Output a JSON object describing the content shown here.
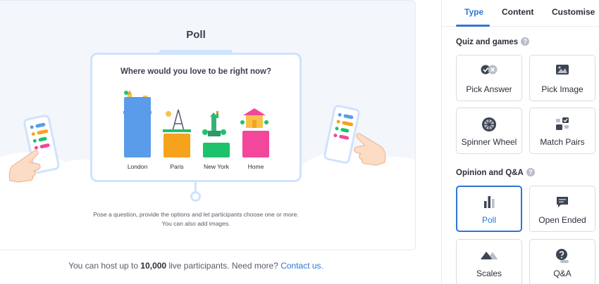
{
  "preview": {
    "title": "Poll",
    "question": "Where would you love to be right now?",
    "bars": [
      {
        "label": "London",
        "value": 5,
        "color": "#5a9ce9"
      },
      {
        "label": "Paris",
        "value": 2,
        "color": "#f6a21d"
      },
      {
        "label": "New York",
        "value": 1.2,
        "color": "#1ec26a"
      },
      {
        "label": "Home",
        "value": 2.2,
        "color": "#f2479a"
      }
    ],
    "description_line1": "Pose a question, provide the options and let participants choose one or more.",
    "description_line2": "You can also add images."
  },
  "footer": {
    "text_before": "You can host up to ",
    "count": "10,000",
    "text_after": " live participants. Need more? ",
    "link": "Contact us."
  },
  "sidebar": {
    "tabs": [
      {
        "label": "Type",
        "active": true
      },
      {
        "label": "Content",
        "active": false
      },
      {
        "label": "Customise",
        "active": false
      }
    ],
    "sections": [
      {
        "title": "Quiz and games",
        "help": "?",
        "cards": [
          {
            "label": "Pick Answer",
            "icon": "check-x-icon",
            "selected": false
          },
          {
            "label": "Pick Image",
            "icon": "image-icon",
            "selected": false
          },
          {
            "label": "Spinner Wheel",
            "icon": "wheel-icon",
            "selected": false
          },
          {
            "label": "Match Pairs",
            "icon": "match-pairs-icon",
            "selected": false
          }
        ]
      },
      {
        "title": "Opinion and Q&A",
        "help": "?",
        "cards": [
          {
            "label": "Poll",
            "icon": "bar-chart-icon",
            "selected": true
          },
          {
            "label": "Open Ended",
            "icon": "chat-icon",
            "selected": false
          },
          {
            "label": "Scales",
            "icon": "mountain-icon",
            "selected": false
          },
          {
            "label": "Q&A",
            "icon": "question-bubble-icon",
            "selected": false
          }
        ]
      }
    ]
  },
  "colors": {
    "accent": "#2f76d2",
    "board_border": "#cfe3fb"
  }
}
